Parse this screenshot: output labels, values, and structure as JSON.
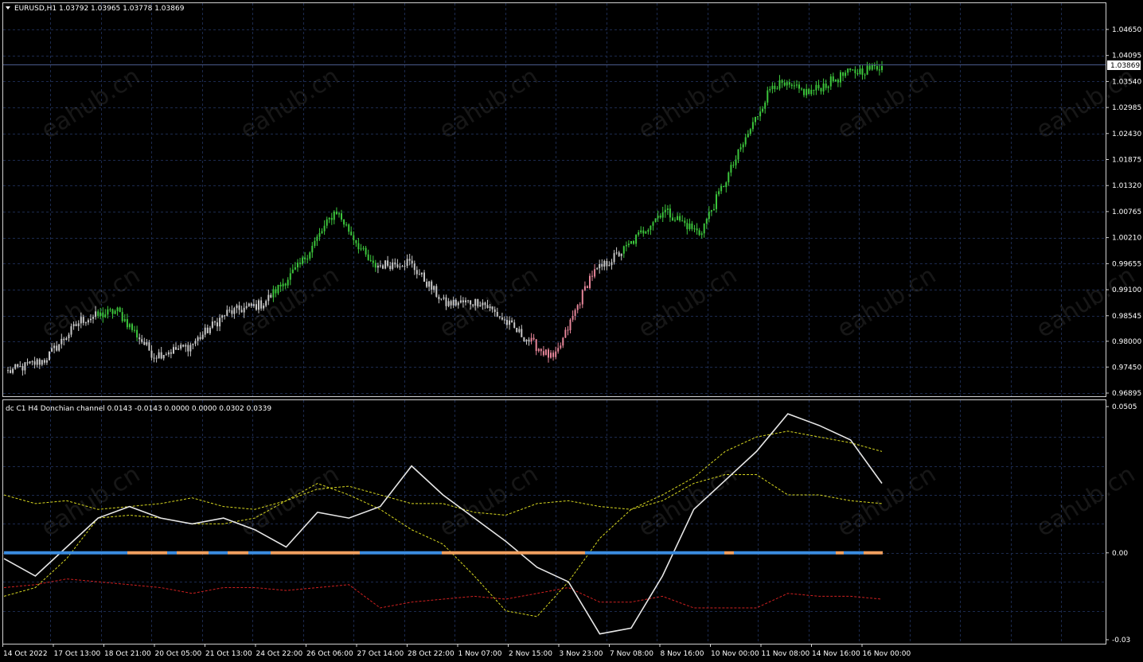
{
  "main_window": {
    "symbol_header": "EURUSD,H1  1.03792 1.03965 1.03778 1.03869",
    "current_price": "1.03869",
    "price_labels": [
      "1.04650",
      "1.04095",
      "1.03540",
      "1.02985",
      "1.02430",
      "1.01875",
      "1.01320",
      "1.00765",
      "1.00210",
      "0.99655",
      "0.99100",
      "0.98545",
      "0.98000",
      "0.97450",
      "0.96895"
    ]
  },
  "indicator_window": {
    "header": "dc C1 H4 Donchian channel 0.0143 -0.0143 0.0000 0.0000 0.0302 0.0339",
    "scale_labels": [
      "0.0505",
      "0.00",
      "-0.03"
    ]
  },
  "time_labels": [
    "14 Oct 2022",
    "17 Oct 13:00",
    "18 Oct 21:00",
    "20 Oct 05:00",
    "21 Oct 13:00",
    "24 Oct 22:00",
    "26 Oct 06:00",
    "27 Oct 14:00",
    "28 Oct 22:00",
    "1 Nov 07:00",
    "2 Nov 15:00",
    "3 Nov 23:00",
    "7 Nov 08:00",
    "8 Nov 16:00",
    "10 Nov 00:00",
    "11 Nov 08:00",
    "14 Nov 16:00",
    "16 Nov 00:00"
  ],
  "watermark": "eahub.cn",
  "icons": {
    "symbol_menu": "triangle-down-icon"
  },
  "colors": {
    "background": "#000000",
    "grid": "#1c2a4e",
    "frame": "#d0d0d0",
    "candle_green": "#3cc63c",
    "candle_gray": "#c8c8c8",
    "candle_pink": "#e7869a",
    "oscillator_line": "#e6e6e6",
    "channel_upper": "#d8d820",
    "channel_lower": "#d02020",
    "state_blue": "#3a8ce0",
    "state_orange": "#f0a060"
  },
  "chart_data": [
    {
      "type": "candlestick",
      "symbol": "EURUSD",
      "timeframe": "H1",
      "ylim": [
        0.96895,
        1.0465
      ],
      "x": [
        "14 Oct",
        "15 Oct",
        "17 Oct",
        "18 Oct",
        "19 Oct",
        "20 Oct",
        "21 Oct",
        "24 Oct",
        "25 Oct",
        "26 Oct",
        "27 Oct",
        "28 Oct",
        "31 Oct",
        "1 Nov",
        "2 Nov",
        "3 Nov",
        "4 Nov",
        "7 Nov",
        "8 Nov",
        "9 Nov",
        "10 Nov",
        "11 Nov",
        "14 Nov",
        "15 Nov",
        "16 Nov"
      ],
      "close": [
        0.9735,
        0.976,
        0.9845,
        0.9865,
        0.977,
        0.979,
        0.986,
        0.988,
        0.996,
        1.008,
        0.996,
        0.997,
        0.988,
        0.9885,
        0.982,
        0.976,
        0.994,
        1.0,
        1.008,
        1.003,
        1.019,
        1.035,
        1.033,
        1.037,
        1.0387
      ],
      "last": {
        "open": 1.03792,
        "high": 1.03965,
        "low": 1.03778,
        "close": 1.03869
      }
    },
    {
      "type": "line",
      "name": "Donchian channel",
      "ylim": [
        -0.03,
        0.0505
      ],
      "series": [
        {
          "values": [
            -0.002,
            -0.008,
            0.002,
            0.012,
            0.016,
            0.012,
            0.01,
            0.012,
            0.008,
            0.002,
            0.014,
            0.012,
            0.016,
            0.03,
            0.02,
            0.012,
            0.004,
            -0.005,
            -0.01,
            -0.028,
            -0.026,
            -0.008,
            0.015,
            0.025,
            0.035,
            0.048,
            0.044,
            0.039,
            0.024
          ]
        },
        {
          "values": [
            0.02,
            0.017,
            0.018,
            0.015,
            0.016,
            0.017,
            0.019,
            0.016,
            0.015,
            0.018,
            0.022,
            0.023,
            0.02,
            0.017,
            0.017,
            0.014,
            0.013,
            0.017,
            0.018,
            0.016,
            0.015,
            0.018,
            0.024,
            0.027,
            0.027,
            0.02,
            0.02,
            0.018,
            0.017
          ]
        },
        {
          "values": [
            -0.012,
            -0.011,
            -0.009,
            -0.01,
            -0.011,
            -0.012,
            -0.014,
            -0.012,
            -0.012,
            -0.013,
            -0.012,
            -0.011,
            -0.019,
            -0.017,
            -0.016,
            -0.015,
            -0.016,
            -0.014,
            -0.012,
            -0.017,
            -0.017,
            -0.015,
            -0.019,
            -0.019,
            -0.019,
            -0.014,
            -0.015,
            -0.015,
            -0.016
          ]
        },
        {
          "values": [
            -0.015,
            -0.012,
            -0.002,
            0.012,
            0.013,
            0.012,
            0.01,
            0.01,
            0.012,
            0.018,
            0.024,
            0.02,
            0.015,
            0.008,
            0.003,
            -0.008,
            -0.02,
            -0.022,
            -0.01,
            0.005,
            0.015,
            0.02,
            0.026,
            0.035,
            0.04,
            0.042,
            0.04,
            0.038,
            0.035
          ]
        }
      ]
    }
  ]
}
